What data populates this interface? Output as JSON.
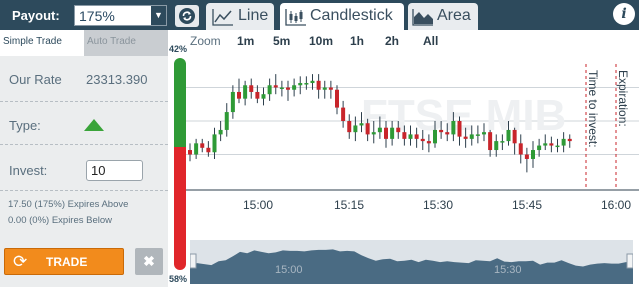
{
  "header": {
    "payout_label": "Payout:",
    "payout_value": "175%",
    "tabs": [
      {
        "label": "Line",
        "active": false
      },
      {
        "label": "Candlestick",
        "active": true
      },
      {
        "label": "Area",
        "active": false
      }
    ],
    "info_label": "i"
  },
  "trade_panel": {
    "subtabs": [
      "Simple Trade",
      "Auto Trade"
    ],
    "our_rate_label": "Our Rate",
    "our_rate_value": "23313.390",
    "type_label": "Type:",
    "type_direction": "up",
    "invest_label": "Invest:",
    "invest_value": "10",
    "expires_above": "17.50 (175%) Expires Above",
    "expires_below": "0.00 (0%) Expires Below",
    "trade_button": "TRADE",
    "cancel_button": "✖"
  },
  "sentiment": {
    "top_pct_label": "42%",
    "bottom_pct_label": "58%",
    "top_fraction": 0.42,
    "colors": {
      "up": "#2f9a36",
      "down": "#e0262a"
    }
  },
  "zoom": {
    "label": "Zoom",
    "options": [
      "1m",
      "5m",
      "10m",
      "1h",
      "2h",
      "All"
    ]
  },
  "chart": {
    "watermark": "FTSE MIB",
    "x_tick_labels": [
      "15:00",
      "15:15",
      "15:30",
      "15:45",
      "16:00"
    ],
    "time_to_invest_label": "Time to invest:",
    "expiration_label": "Expiration:",
    "navigator_tick_labels": [
      "15:00",
      "15:30"
    ],
    "colors": {
      "up": "#2e9a36",
      "down": "#c8252b",
      "accent": "#2d4a5c"
    }
  },
  "chart_data": {
    "type": "candlestick",
    "title": "",
    "x": [
      "14:48",
      "14:49",
      "14:50",
      "14:51",
      "14:52",
      "14:53",
      "14:54",
      "14:55",
      "14:56",
      "14:57",
      "14:58",
      "14:59",
      "15:00",
      "15:01",
      "15:02",
      "15:03",
      "15:04",
      "15:05",
      "15:06",
      "15:07",
      "15:08",
      "15:09",
      "15:10",
      "15:11",
      "15:12",
      "15:13",
      "15:14",
      "15:15",
      "15:16",
      "15:17",
      "15:18",
      "15:19",
      "15:20",
      "15:21",
      "15:22",
      "15:23",
      "15:24",
      "15:25",
      "15:26",
      "15:27",
      "15:28",
      "15:29",
      "15:30",
      "15:31",
      "15:32",
      "15:33",
      "15:34",
      "15:35",
      "15:36",
      "15:37",
      "15:38",
      "15:39",
      "15:40",
      "15:41",
      "15:42",
      "15:43",
      "15:44",
      "15:45",
      "15:46",
      "15:47",
      "15:48",
      "15:49",
      "15:50"
    ],
    "series": [
      {
        "open": [
          57,
          55,
          60,
          58,
          56,
          64,
          66,
          74,
          83,
          80,
          86,
          83,
          80,
          82,
          86,
          85,
          85,
          84,
          86,
          87,
          87,
          88,
          84,
          85,
          84,
          76,
          70,
          65,
          68,
          69,
          64,
          65,
          67,
          62,
          67,
          65,
          62,
          64,
          62,
          61,
          60,
          66,
          65,
          64,
          70,
          63,
          62,
          64,
          64,
          65,
          57,
          61,
          61,
          66,
          60,
          55,
          53,
          57,
          59,
          60,
          59,
          59,
          62
        ],
        "close": [
          55,
          60,
          58,
          56,
          64,
          66,
          74,
          83,
          80,
          86,
          83,
          80,
          82,
          86,
          85,
          85,
          84,
          86,
          87,
          87,
          88,
          84,
          85,
          84,
          76,
          70,
          65,
          68,
          69,
          64,
          65,
          67,
          62,
          67,
          65,
          62,
          64,
          62,
          61,
          60,
          66,
          65,
          64,
          70,
          63,
          62,
          64,
          64,
          65,
          57,
          61,
          61,
          66,
          60,
          55,
          53,
          57,
          59,
          60,
          59,
          59,
          62,
          61
        ],
        "high": [
          60,
          62,
          62,
          61,
          67,
          70,
          78,
          86,
          89,
          88,
          89,
          86,
          85,
          89,
          91,
          88,
          88,
          89,
          90,
          90,
          91,
          91,
          88,
          88,
          86,
          79,
          73,
          72,
          74,
          71,
          70,
          72,
          70,
          70,
          70,
          68,
          68,
          67,
          66,
          64,
          70,
          70,
          69,
          74,
          72,
          67,
          68,
          68,
          69,
          66,
          64,
          64,
          70,
          67,
          64,
          58,
          61,
          62,
          64,
          63,
          62,
          65,
          64
        ],
        "low": [
          52,
          53,
          56,
          54,
          53,
          61,
          63,
          71,
          78,
          77,
          80,
          78,
          77,
          79,
          82,
          81,
          79,
          81,
          82,
          84,
          84,
          80,
          80,
          80,
          73,
          67,
          62,
          61,
          65,
          61,
          60,
          62,
          58,
          59,
          62,
          59,
          59,
          58,
          57,
          56,
          58,
          62,
          61,
          61,
          59,
          58,
          59,
          60,
          61,
          54,
          54,
          57,
          59,
          55,
          51,
          47,
          49,
          54,
          57,
          56,
          56,
          56,
          58
        ]
      }
    ],
    "ylim": [
      40,
      100
    ],
    "xlim": [
      "14:48",
      "16:00"
    ],
    "markers": [
      {
        "label": "Time to invest:",
        "x": "15:55"
      },
      {
        "label": "Expiration:",
        "x": "16:00"
      }
    ],
    "grid": true
  }
}
